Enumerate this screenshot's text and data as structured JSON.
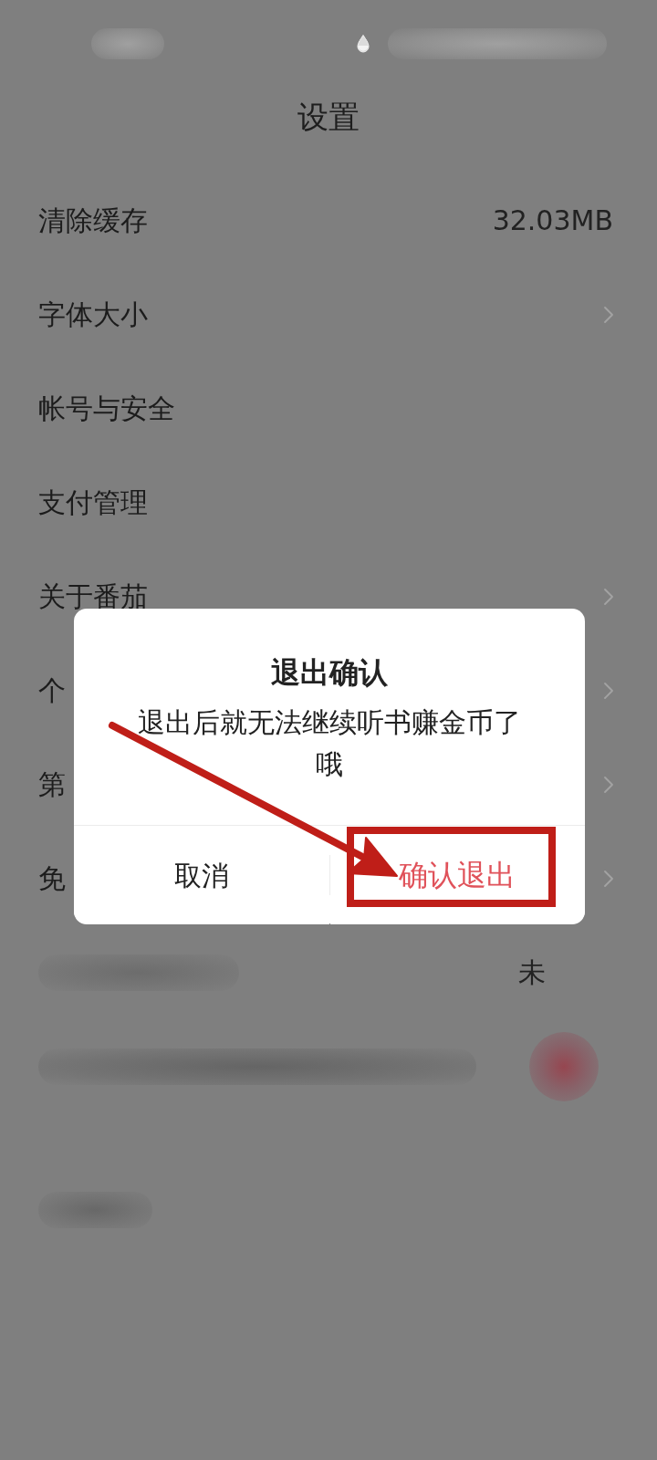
{
  "header": {
    "title": "设置"
  },
  "settings": [
    {
      "kind": "item",
      "label": "清除缓存",
      "value": "32.03MB",
      "chevron": false
    },
    {
      "kind": "item",
      "label": "字体大小",
      "chevron": true
    },
    {
      "kind": "item",
      "label": "帐号与安全",
      "chevron": false
    },
    {
      "kind": "item",
      "label": "支付管理",
      "chevron": false
    },
    {
      "kind": "item",
      "label": "关于番茄",
      "chevron": true
    },
    {
      "kind": "item",
      "label": "个",
      "chevron": true
    },
    {
      "kind": "item",
      "label": "第",
      "chevron": true
    },
    {
      "kind": "item",
      "label": "免",
      "chevron": true
    },
    {
      "kind": "redacted",
      "value": "未",
      "chevron": false
    },
    {
      "kind": "redacted",
      "dot": true,
      "chevron": false
    }
  ],
  "footer": {
    "kind": "redacted"
  },
  "dialog": {
    "title": "退出确认",
    "message": "退出后就无法继续听书赚金币了哦",
    "buttons": [
      {
        "label": "取消",
        "kind": "cancel",
        "highlighted": false
      },
      {
        "label": "确认退出",
        "kind": "confirm",
        "highlighted": true
      }
    ]
  }
}
